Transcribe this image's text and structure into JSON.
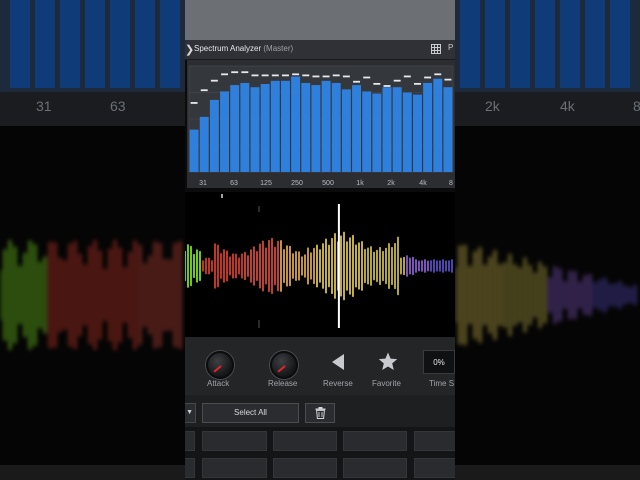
{
  "window": {
    "title": "Spectrum Analyzer",
    "subtitle": "(Master)",
    "panel_cut_label": "P"
  },
  "spectrum": {
    "freq_labels": [
      "31",
      "63",
      "125",
      "250",
      "500",
      "1k",
      "2k",
      "4k",
      "8"
    ],
    "side_freq_labels_left": [
      "31",
      "63"
    ],
    "side_freq_labels_right": [
      "2k",
      "4k",
      "8"
    ],
    "bar_levels": [
      0.4,
      0.52,
      0.68,
      0.76,
      0.82,
      0.84,
      0.8,
      0.83,
      0.86,
      0.86,
      0.9,
      0.84,
      0.82,
      0.86,
      0.84,
      0.78,
      0.82,
      0.76,
      0.74,
      0.8,
      0.8,
      0.75,
      0.73,
      0.84,
      0.88,
      0.8
    ],
    "peak_levels": [
      0.66,
      0.78,
      0.87,
      0.93,
      0.95,
      0.95,
      0.92,
      0.92,
      0.92,
      0.92,
      0.93,
      0.92,
      0.91,
      0.91,
      0.92,
      0.91,
      0.86,
      0.9,
      0.84,
      0.82,
      0.87,
      0.91,
      0.84,
      0.9,
      0.93,
      0.88
    ],
    "bar_color": "#2f80dd",
    "peak_color": "#e6e8ec"
  },
  "waveform": {
    "playhead_fraction": 0.57,
    "colors": [
      "#7be020",
      "#d73a2b",
      "#d1483a",
      "#d8a44a",
      "#d8c14e",
      "#c7b84a",
      "#8a5bd0",
      "#5a4cc4"
    ]
  },
  "controls": {
    "attack_label": "Attack",
    "release_label": "Release",
    "reverse_label": "Reverse",
    "favorite_label": "Favorite",
    "time_label": "Time S",
    "time_value": "0%"
  },
  "selection": {
    "select_all_label": "Select All"
  },
  "colors": {
    "accent_red": "#e0262c",
    "panel_bg": "#242527"
  }
}
